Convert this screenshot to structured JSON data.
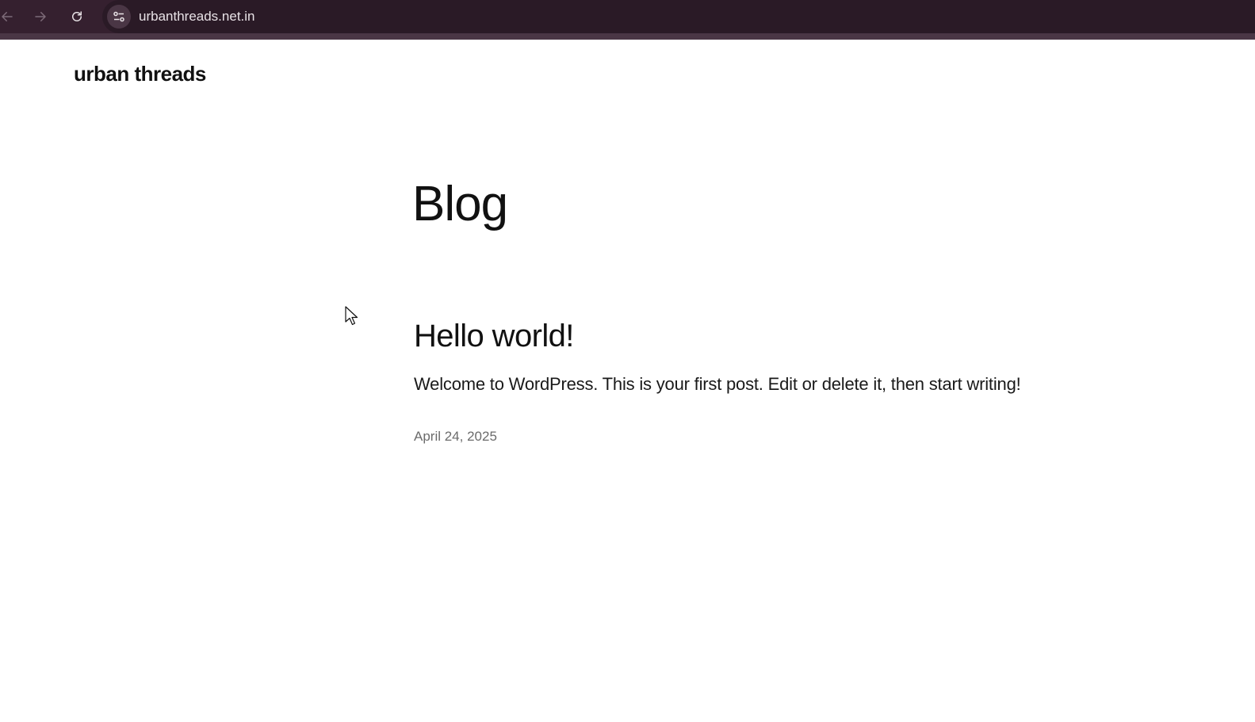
{
  "browser": {
    "url": "urbanthreads.net.in",
    "back_icon": "arrow-left-icon",
    "forward_icon": "arrow-right-icon",
    "reload_icon": "reload-icon",
    "site_info_icon": "tune-icon"
  },
  "site": {
    "title": "urban threads"
  },
  "page": {
    "heading": "Blog"
  },
  "posts": [
    {
      "title": "Hello world!",
      "excerpt": "Welcome to WordPress. This is your first post. Edit or delete it, then start writing!",
      "date": "April 24, 2025"
    }
  ],
  "colors": {
    "browser_bar": "#35202f",
    "text": "#111111",
    "date": "#6b6b6b"
  }
}
